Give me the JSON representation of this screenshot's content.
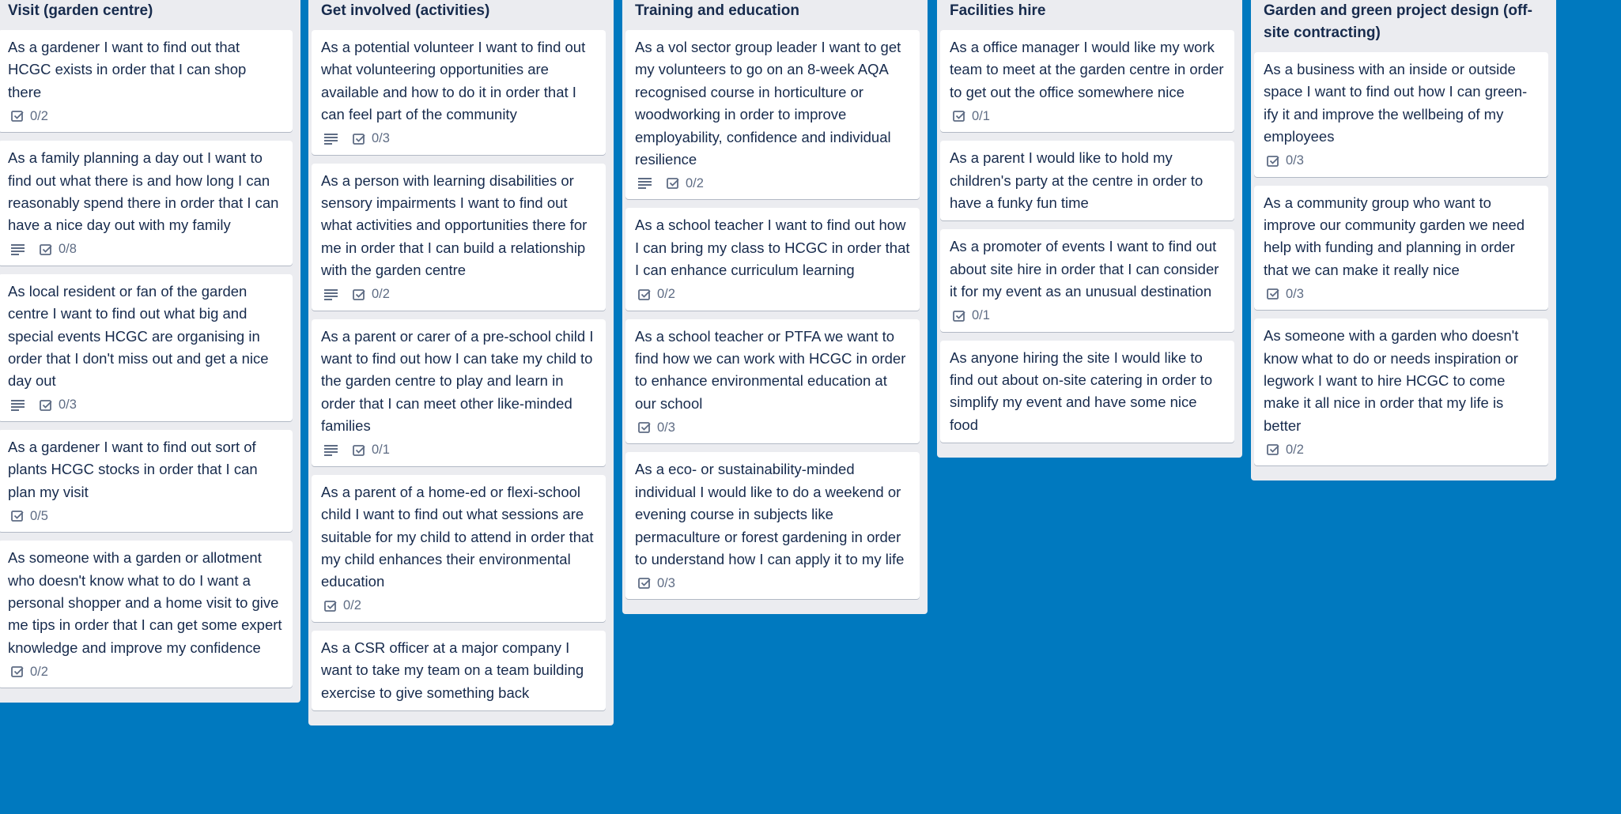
{
  "board": {
    "background_color": "#0079bf",
    "lists": [
      {
        "title": "Visit (garden centre)",
        "cards": [
          {
            "title": "As a gardener I want to find out that HCGC exists in order that I can shop there",
            "description": false,
            "checklist": "0/2"
          },
          {
            "title": "As a family planning a day out I want to find out what there is and how long I can reasonably spend there in order that I can have a nice day out with my family",
            "description": true,
            "checklist": "0/8"
          },
          {
            "title": "As local resident or fan of the garden centre I want to find out what big and special events HCGC are organising in order that I don't miss out and get a nice day out",
            "description": true,
            "checklist": "0/3"
          },
          {
            "title": "As a gardener I want to find out sort of plants HCGC stocks in order that I can plan my visit",
            "description": false,
            "checklist": "0/5"
          },
          {
            "title": "As someone with a garden or allotment who doesn't know what to do I want a personal shopper and a home visit to give me tips in order that I can get some expert knowledge and improve my confidence",
            "description": false,
            "checklist": "0/2"
          }
        ]
      },
      {
        "title": "Get involved (activities)",
        "cards": [
          {
            "title": "As a potential volunteer I want to find out what volunteering opportunities are available and how to do it in order that I can feel part of the community",
            "description": true,
            "checklist": "0/3"
          },
          {
            "title": "As a person with learning disabilities or sensory impairments I want to find out what activities and opportunities there for me in order that I can build a relationship with the garden centre",
            "description": true,
            "checklist": "0/2"
          },
          {
            "title": "As a parent or carer of a pre-school child I want to find out how I can take my child to the garden centre to play and learn in order that I can meet other like-minded families",
            "description": true,
            "checklist": "0/1"
          },
          {
            "title": "As a parent of a home-ed or flexi-school child I want to find out what sessions are suitable for my child to attend in order that my child enhances their environmental education",
            "description": false,
            "checklist": "0/2"
          },
          {
            "title": "As a CSR officer at a major company I want to take my team on a team building exercise to give something back",
            "description": false,
            "checklist": null
          }
        ]
      },
      {
        "title": "Training and education",
        "cards": [
          {
            "title": "As a vol sector group leader I want to get my volunteers to go on an 8-week AQA recognised course in horticulture or woodworking in order to improve employability, confidence and individual resilience",
            "description": true,
            "checklist": "0/2"
          },
          {
            "title": "As a school teacher I want to find out how I can bring my class to HCGC in order that I can enhance curriculum learning",
            "description": false,
            "checklist": "0/2"
          },
          {
            "title": "As a school teacher or PTFA we want to find how we can work with HCGC in order to enhance environmental education at our school",
            "description": false,
            "checklist": "0/3"
          },
          {
            "title": "As a eco- or sustainability-minded individual I would like to do a weekend or evening course in subjects like permaculture or forest gardening in order to understand how I can apply it to my life",
            "description": false,
            "checklist": "0/3"
          }
        ]
      },
      {
        "title": "Facilities hire",
        "cards": [
          {
            "title": "As a office manager I would like my work team to meet at the garden centre in order to get out the office somewhere nice",
            "description": false,
            "checklist": "0/1"
          },
          {
            "title": "As a parent I would like to hold my children's party at the centre in order to have a funky fun time",
            "description": false,
            "checklist": null
          },
          {
            "title": "As a promoter of events I want to find out about site hire in order that I can consider it for my event as an unusual destination",
            "description": false,
            "checklist": "0/1"
          },
          {
            "title": "As anyone hiring the site I would like to find out about on-site catering in order to simplify my event and have some nice food",
            "description": false,
            "checklist": null
          }
        ]
      },
      {
        "title": "Garden and green project design (off-site contracting)",
        "cards": [
          {
            "title": "As a business with an inside or outside space I want to find out how I can green-ify it and improve the wellbeing of my employees",
            "description": false,
            "checklist": "0/3"
          },
          {
            "title": "As a community group who want to improve our community garden we need help with funding and planning in order that we can make it really nice",
            "description": false,
            "checklist": "0/3"
          },
          {
            "title": "As someone with a garden who doesn't know what to do or needs inspiration or legwork I want to hire HCGC to come make it all nice in order that my life is better",
            "description": false,
            "checklist": "0/2"
          }
        ]
      }
    ]
  }
}
